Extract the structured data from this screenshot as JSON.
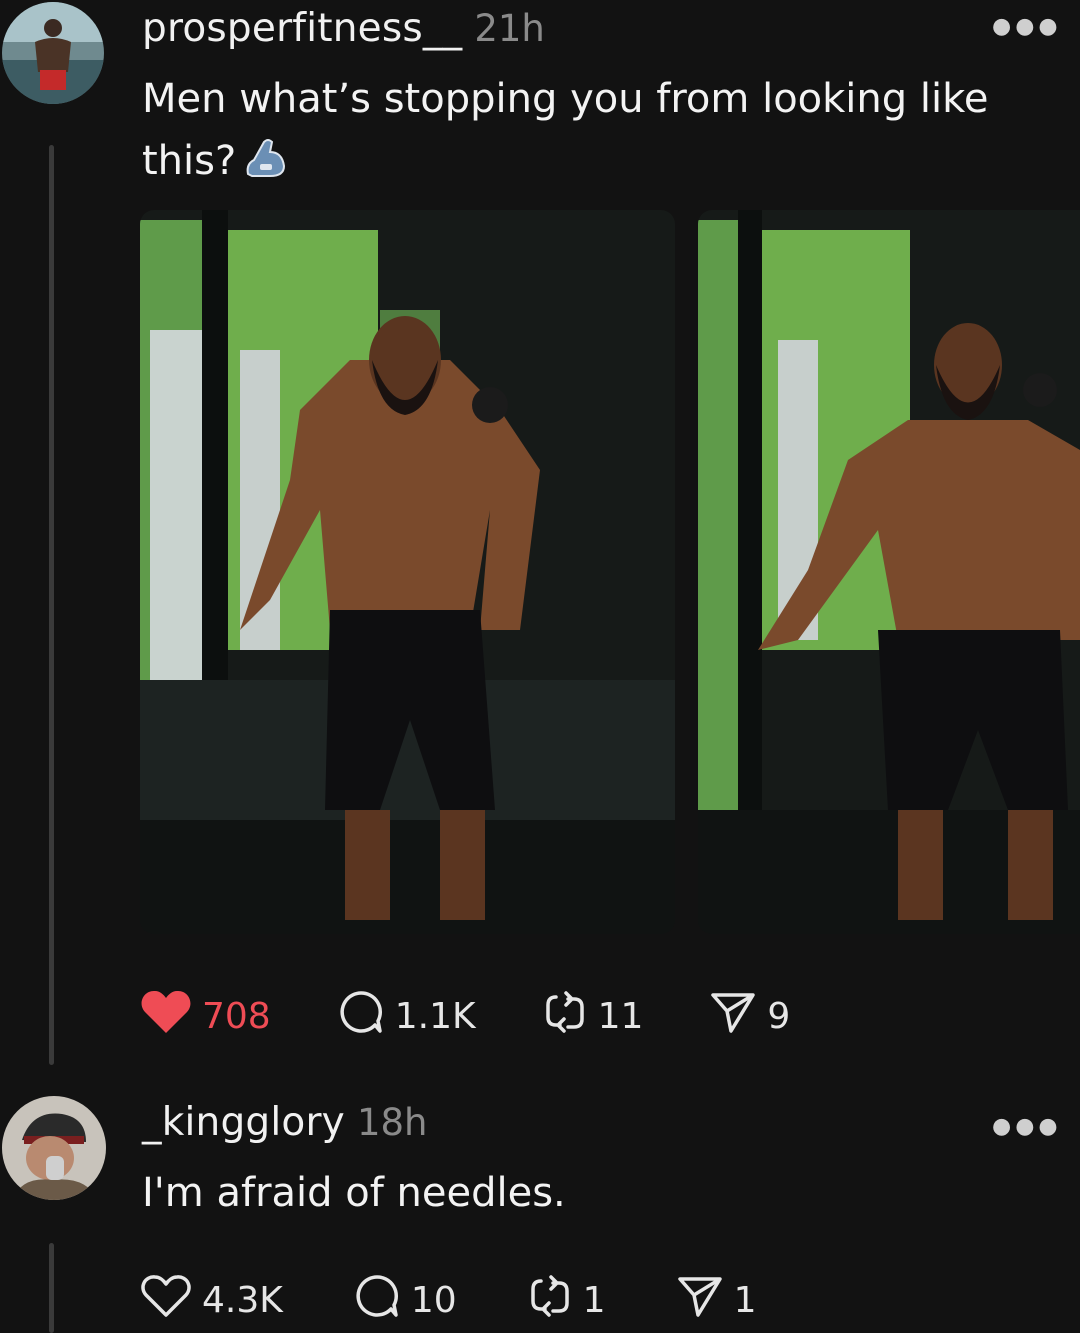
{
  "post": {
    "username": "prosperfitness__",
    "time": "21h",
    "text": "Men what’s stopping you from looking like this?",
    "emoji": "💪",
    "likes": "708",
    "comments": "1.1K",
    "reposts": "11",
    "shares": "9",
    "liked": true
  },
  "reply": {
    "username": "_kingglory",
    "time": "18h",
    "text": "I'm afraid of needles.",
    "likes": "4.3K",
    "comments": "10",
    "reposts": "1",
    "shares": "1"
  },
  "colors": {
    "background": "#121212",
    "like_red": "#ef4c55",
    "muted": "#8a8a8a"
  },
  "icons": [
    "more-icon",
    "heart-icon",
    "comment-icon",
    "repost-icon",
    "share-icon",
    "flexed-biceps-icon"
  ]
}
